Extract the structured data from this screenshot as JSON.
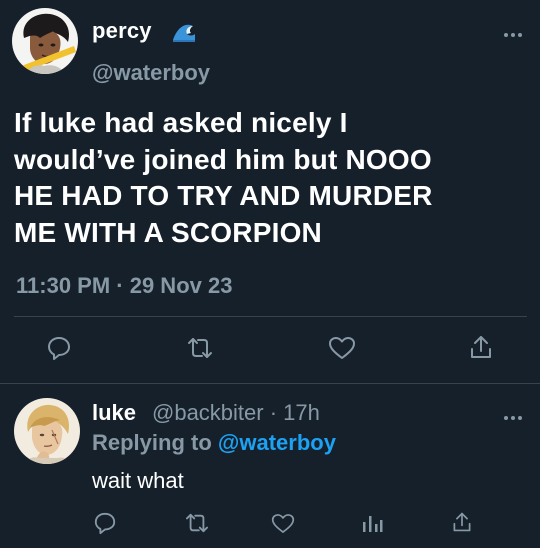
{
  "main_tweet": {
    "display_name": "percy",
    "name_emoji_icon": "wave-emoji-icon",
    "handle": "@waterboy",
    "text_lines": [
      "If luke had asked nicely I",
      "would’ve joined him but NOOO",
      "HE HAD TO TRY AND MURDER",
      "ME WITH A SCORPION"
    ],
    "timestamp": "11:30 PM · 29 Nov 23",
    "actions": [
      "reply-icon",
      "retweet-icon",
      "like-icon",
      "share-icon"
    ]
  },
  "reply_tweet": {
    "display_name": "luke",
    "meta": "@backbiter · 17h",
    "replying_prefix": "Replying to",
    "replying_handle": "@waterboy",
    "text": "wait what",
    "actions": [
      "reply-icon",
      "retweet-icon",
      "like-icon",
      "analytics-icon",
      "share-icon"
    ]
  },
  "colors": {
    "background": "#15202b",
    "text": "#ffffff",
    "secondary": "#8899a6",
    "link": "#1da1f2",
    "divider": "#38444d"
  }
}
